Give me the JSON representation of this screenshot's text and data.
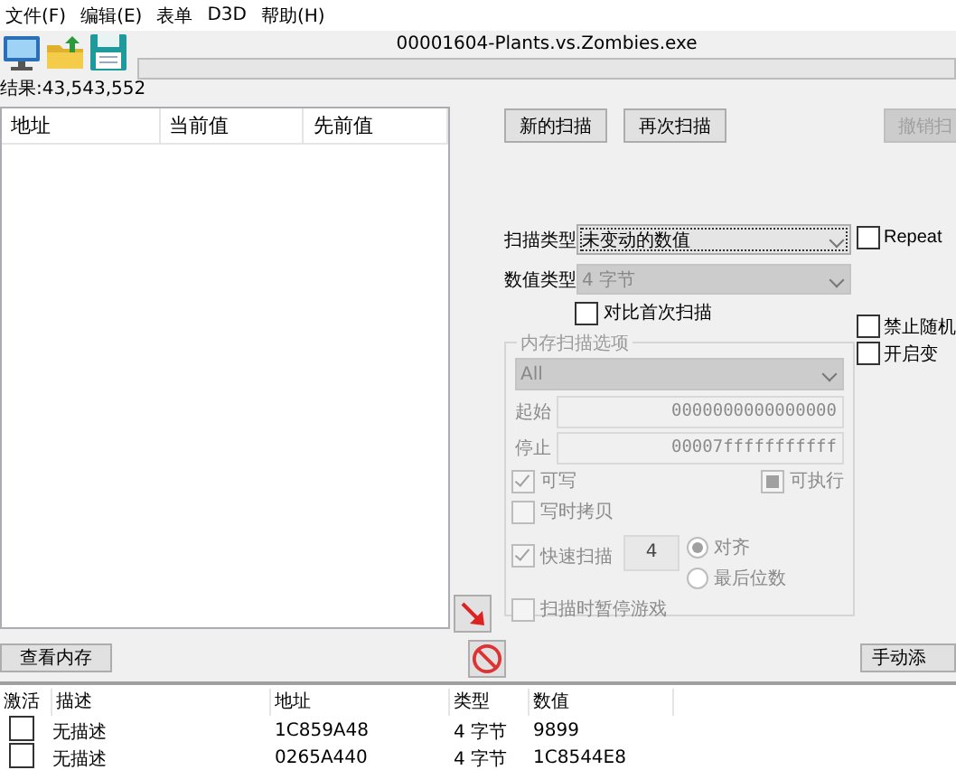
{
  "menu": [
    {
      "label": "文件(F)"
    },
    {
      "label": "编辑(E)"
    },
    {
      "label": "表单"
    },
    {
      "label": "D3D"
    },
    {
      "label": "帮助(H)"
    }
  ],
  "title": "00001604-Plants.vs.Zombies.exe",
  "progress": {
    "level": 0
  },
  "result_count": "结果:43,543,552",
  "found_list": {
    "columns": [
      "地址",
      "当前值",
      "先前值"
    ]
  },
  "scan_buttons": [
    {
      "label": "新的扫描",
      "disabled": false
    },
    {
      "label": "再次扫描",
      "disabled": false
    },
    {
      "label": "撤销扫",
      "disabled": true
    }
  ],
  "scan_type": {
    "label": "扫描类型",
    "value": "未变动的数值",
    "disabled": false
  },
  "value_type": {
    "label": "数值类型",
    "value": "4 字节",
    "disabled": true
  },
  "repeat": {
    "label": "Repeat",
    "checked": false
  },
  "compare_first": {
    "label": "对比首次扫描",
    "checked": false
  },
  "side_options": [
    {
      "label": "禁止随机",
      "checked": false
    },
    {
      "label": "开启变",
      "checked": false
    }
  ],
  "memory_options": {
    "title": "内存扫描选项",
    "disabled": true,
    "region": "All",
    "start_label": "起始",
    "start": "0000000000000000",
    "stop_label": "停止",
    "stop": "00007fffffffffff",
    "writable": {
      "label": "可写",
      "checked": true
    },
    "executable": {
      "label": "可执行",
      "checked": false,
      "indeterminate": true
    },
    "copy_on_write": {
      "label": "写时拷贝",
      "checked": false
    },
    "fast_scan": {
      "label": "快速扫描",
      "checked": true,
      "value": "4"
    },
    "alignment": [
      {
        "label": "对齐",
        "selected": true
      },
      {
        "label": "最后位数",
        "selected": false
      }
    ],
    "pause_game": {
      "label": "扫描时暂停游戏",
      "checked": false
    }
  },
  "view_memory_button": "查看内存",
  "add_address_button": "手动添",
  "address_table": {
    "columns": [
      "激活",
      "描述",
      "地址",
      "类型",
      "数值"
    ],
    "rows": [
      {
        "active": false,
        "description": "无描述",
        "address": "1C859A48",
        "type": "4 字节",
        "value": "9899"
      },
      {
        "active": false,
        "description": "无描述",
        "address": "0265A440",
        "type": "4 字节",
        "value": "1C8544E8"
      }
    ]
  }
}
